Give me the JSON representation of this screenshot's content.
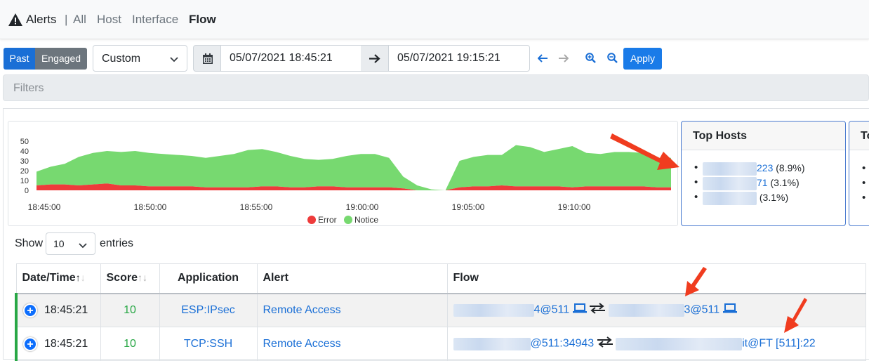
{
  "header": {
    "title": "Alerts",
    "separator": "|",
    "nav": [
      "All",
      "Host",
      "Interface",
      "Flow"
    ],
    "active": "Flow"
  },
  "toolbar": {
    "past_label": "Past",
    "engaged_label": "Engaged",
    "range_select": "Custom",
    "date_from": "05/07/2021 18:45:21",
    "date_to": "05/07/2021 19:15:21",
    "apply_label": "Apply",
    "filters_placeholder": "Filters"
  },
  "chart_data": {
    "type": "area",
    "series": [
      {
        "name": "Error",
        "color": "#ee3b3b",
        "values": [
          5,
          6,
          6,
          5,
          6,
          7,
          5,
          5,
          4,
          4,
          4,
          4,
          3,
          3,
          3,
          3,
          4,
          4,
          3,
          3,
          4,
          4,
          3,
          3,
          3,
          3,
          2,
          0,
          0,
          0,
          3,
          4,
          4,
          5,
          4,
          4,
          4,
          4,
          3,
          4,
          4,
          4,
          4,
          4,
          3,
          3
        ]
      },
      {
        "name": "Notice",
        "color": "#77d970",
        "values": [
          14,
          18,
          21,
          29,
          32,
          33,
          34,
          35,
          34,
          33,
          32,
          31,
          30,
          32,
          34,
          38,
          38,
          35,
          32,
          29,
          27,
          28,
          32,
          34,
          34,
          30,
          12,
          5,
          1,
          0,
          27,
          30,
          32,
          31,
          42,
          40,
          35,
          38,
          42,
          34,
          33,
          35,
          35,
          34,
          30,
          30
        ]
      }
    ],
    "y_ticks": [
      "50",
      "40",
      "30",
      "20",
      "10",
      "0"
    ],
    "ylim": [
      0,
      50
    ],
    "x_ticks": [
      "18:45:00",
      "18:50:00",
      "18:55:00",
      "19:00:00",
      "19:05:00",
      "19:10:00"
    ],
    "legend": [
      "Error",
      "Notice"
    ],
    "legend_position": "bottom"
  },
  "top_hosts": {
    "title": "Top Hosts",
    "items": [
      {
        "label": "223",
        "pct": "(8.9%)"
      },
      {
        "label": "71",
        "pct": "(3.1%)"
      },
      {
        "label": "",
        "pct": "(3.1%)"
      }
    ],
    "next_title": "To"
  },
  "table_controls": {
    "show": "Show",
    "length": "10",
    "entries": "entries"
  },
  "table": {
    "headers": [
      "Date/Time",
      "Score",
      "Application",
      "Alert",
      "Flow"
    ],
    "rows": [
      {
        "time": "18:45:21",
        "score": "10",
        "app": "ESP:IPsec",
        "alert": "Remote Access",
        "src": "4@511",
        "dst": "3@511"
      },
      {
        "time": "18:45:21",
        "score": "10",
        "app": "TCP:SSH",
        "alert": "Remote Access",
        "src": "@511:34943",
        "dst": "it@FT [511]:22"
      }
    ]
  },
  "colors": {
    "accent": "#1a6fd6",
    "error": "#ee3b3b",
    "notice": "#77d970",
    "score": "#28a745"
  }
}
